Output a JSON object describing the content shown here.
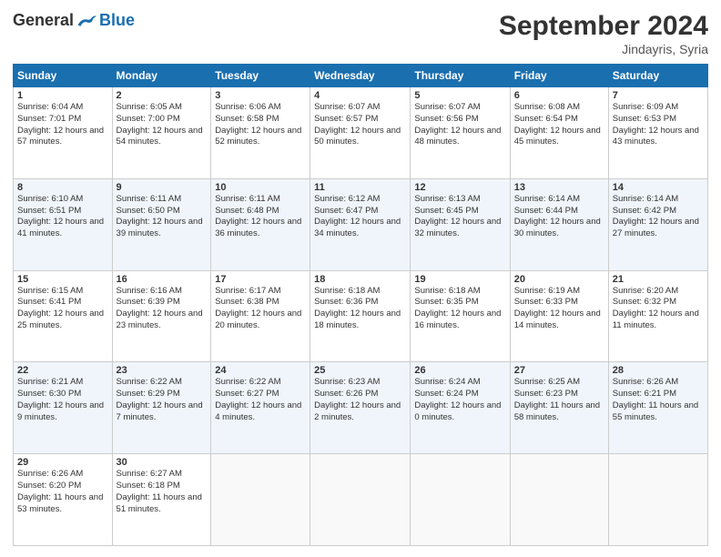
{
  "logo": {
    "general": "General",
    "blue": "Blue"
  },
  "title": "September 2024",
  "subtitle": "Jindayris, Syria",
  "headers": [
    "Sunday",
    "Monday",
    "Tuesday",
    "Wednesday",
    "Thursday",
    "Friday",
    "Saturday"
  ],
  "weeks": [
    [
      {
        "day": "1",
        "sunrise": "Sunrise: 6:04 AM",
        "sunset": "Sunset: 7:01 PM",
        "daylight": "Daylight: 12 hours and 57 minutes."
      },
      {
        "day": "2",
        "sunrise": "Sunrise: 6:05 AM",
        "sunset": "Sunset: 7:00 PM",
        "daylight": "Daylight: 12 hours and 54 minutes."
      },
      {
        "day": "3",
        "sunrise": "Sunrise: 6:06 AM",
        "sunset": "Sunset: 6:58 PM",
        "daylight": "Daylight: 12 hours and 52 minutes."
      },
      {
        "day": "4",
        "sunrise": "Sunrise: 6:07 AM",
        "sunset": "Sunset: 6:57 PM",
        "daylight": "Daylight: 12 hours and 50 minutes."
      },
      {
        "day": "5",
        "sunrise": "Sunrise: 6:07 AM",
        "sunset": "Sunset: 6:56 PM",
        "daylight": "Daylight: 12 hours and 48 minutes."
      },
      {
        "day": "6",
        "sunrise": "Sunrise: 6:08 AM",
        "sunset": "Sunset: 6:54 PM",
        "daylight": "Daylight: 12 hours and 45 minutes."
      },
      {
        "day": "7",
        "sunrise": "Sunrise: 6:09 AM",
        "sunset": "Sunset: 6:53 PM",
        "daylight": "Daylight: 12 hours and 43 minutes."
      }
    ],
    [
      {
        "day": "8",
        "sunrise": "Sunrise: 6:10 AM",
        "sunset": "Sunset: 6:51 PM",
        "daylight": "Daylight: 12 hours and 41 minutes."
      },
      {
        "day": "9",
        "sunrise": "Sunrise: 6:11 AM",
        "sunset": "Sunset: 6:50 PM",
        "daylight": "Daylight: 12 hours and 39 minutes."
      },
      {
        "day": "10",
        "sunrise": "Sunrise: 6:11 AM",
        "sunset": "Sunset: 6:48 PM",
        "daylight": "Daylight: 12 hours and 36 minutes."
      },
      {
        "day": "11",
        "sunrise": "Sunrise: 6:12 AM",
        "sunset": "Sunset: 6:47 PM",
        "daylight": "Daylight: 12 hours and 34 minutes."
      },
      {
        "day": "12",
        "sunrise": "Sunrise: 6:13 AM",
        "sunset": "Sunset: 6:45 PM",
        "daylight": "Daylight: 12 hours and 32 minutes."
      },
      {
        "day": "13",
        "sunrise": "Sunrise: 6:14 AM",
        "sunset": "Sunset: 6:44 PM",
        "daylight": "Daylight: 12 hours and 30 minutes."
      },
      {
        "day": "14",
        "sunrise": "Sunrise: 6:14 AM",
        "sunset": "Sunset: 6:42 PM",
        "daylight": "Daylight: 12 hours and 27 minutes."
      }
    ],
    [
      {
        "day": "15",
        "sunrise": "Sunrise: 6:15 AM",
        "sunset": "Sunset: 6:41 PM",
        "daylight": "Daylight: 12 hours and 25 minutes."
      },
      {
        "day": "16",
        "sunrise": "Sunrise: 6:16 AM",
        "sunset": "Sunset: 6:39 PM",
        "daylight": "Daylight: 12 hours and 23 minutes."
      },
      {
        "day": "17",
        "sunrise": "Sunrise: 6:17 AM",
        "sunset": "Sunset: 6:38 PM",
        "daylight": "Daylight: 12 hours and 20 minutes."
      },
      {
        "day": "18",
        "sunrise": "Sunrise: 6:18 AM",
        "sunset": "Sunset: 6:36 PM",
        "daylight": "Daylight: 12 hours and 18 minutes."
      },
      {
        "day": "19",
        "sunrise": "Sunrise: 6:18 AM",
        "sunset": "Sunset: 6:35 PM",
        "daylight": "Daylight: 12 hours and 16 minutes."
      },
      {
        "day": "20",
        "sunrise": "Sunrise: 6:19 AM",
        "sunset": "Sunset: 6:33 PM",
        "daylight": "Daylight: 12 hours and 14 minutes."
      },
      {
        "day": "21",
        "sunrise": "Sunrise: 6:20 AM",
        "sunset": "Sunset: 6:32 PM",
        "daylight": "Daylight: 12 hours and 11 minutes."
      }
    ],
    [
      {
        "day": "22",
        "sunrise": "Sunrise: 6:21 AM",
        "sunset": "Sunset: 6:30 PM",
        "daylight": "Daylight: 12 hours and 9 minutes."
      },
      {
        "day": "23",
        "sunrise": "Sunrise: 6:22 AM",
        "sunset": "Sunset: 6:29 PM",
        "daylight": "Daylight: 12 hours and 7 minutes."
      },
      {
        "day": "24",
        "sunrise": "Sunrise: 6:22 AM",
        "sunset": "Sunset: 6:27 PM",
        "daylight": "Daylight: 12 hours and 4 minutes."
      },
      {
        "day": "25",
        "sunrise": "Sunrise: 6:23 AM",
        "sunset": "Sunset: 6:26 PM",
        "daylight": "Daylight: 12 hours and 2 minutes."
      },
      {
        "day": "26",
        "sunrise": "Sunrise: 6:24 AM",
        "sunset": "Sunset: 6:24 PM",
        "daylight": "Daylight: 12 hours and 0 minutes."
      },
      {
        "day": "27",
        "sunrise": "Sunrise: 6:25 AM",
        "sunset": "Sunset: 6:23 PM",
        "daylight": "Daylight: 11 hours and 58 minutes."
      },
      {
        "day": "28",
        "sunrise": "Sunrise: 6:26 AM",
        "sunset": "Sunset: 6:21 PM",
        "daylight": "Daylight: 11 hours and 55 minutes."
      }
    ],
    [
      {
        "day": "29",
        "sunrise": "Sunrise: 6:26 AM",
        "sunset": "Sunset: 6:20 PM",
        "daylight": "Daylight: 11 hours and 53 minutes."
      },
      {
        "day": "30",
        "sunrise": "Sunrise: 6:27 AM",
        "sunset": "Sunset: 6:18 PM",
        "daylight": "Daylight: 11 hours and 51 minutes."
      },
      null,
      null,
      null,
      null,
      null
    ]
  ]
}
